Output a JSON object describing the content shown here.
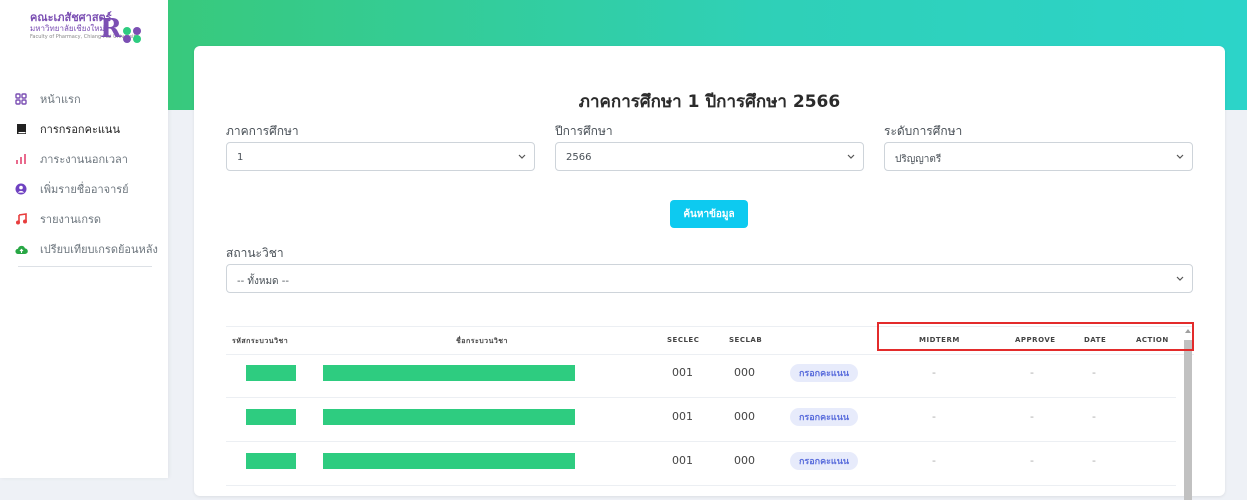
{
  "brand": {
    "line1": "คณะเภสัชศาสตร์",
    "line2": "มหาวิทยาลัยเชียงใหม่",
    "line3": "Faculty of Pharmacy, Chiang Mai University",
    "letter": "R",
    "colors": {
      "primary": "#7b4fb3",
      "accent": "#2ecc80"
    }
  },
  "sidebar": {
    "items": [
      {
        "label": "หน้าแรก",
        "icon": "dashboard-icon",
        "color": "#7b4fb3"
      },
      {
        "label": "การกรอกคะแนน",
        "icon": "book-icon",
        "color": "#222222"
      },
      {
        "label": "ภาระงานนอกเวลา",
        "icon": "bar-chart-icon",
        "color": "#e96a8d"
      },
      {
        "label": "เพิ่มรายชื่ออาจารย์",
        "icon": "user-circle-icon",
        "color": "#6f42c1"
      },
      {
        "label": "รายงานเกรด",
        "icon": "music-note-icon",
        "color": "#e83e3e"
      },
      {
        "label": "เปรียบเทียบเกรดย้อนหลัง",
        "icon": "cloud-upload-icon",
        "color": "#28a745"
      }
    ]
  },
  "main": {
    "title": "ภาคการศึกษา 1 ปีการศึกษา 2566",
    "filters": {
      "semester": {
        "label": "ภาคการศึกษา",
        "value": "1"
      },
      "year": {
        "label": "ปีการศึกษา",
        "value": "2566"
      },
      "level": {
        "label": "ระดับการศึกษา",
        "value": "ปริญญาตรี"
      },
      "status": {
        "label": "สถานะวิชา",
        "value": "-- ทั้งหมด --"
      }
    },
    "search_label": "ค้นหาข้อมูล",
    "table": {
      "headers": [
        "รหัสกระบวนวิชา",
        "ชื่อกระบวนวิชา",
        "SECLEC",
        "SECLAB",
        "MIDTERM",
        "APPROVE",
        "DATE",
        "ACTION"
      ],
      "rows": [
        {
          "seclec": "001",
          "seclab": "000",
          "action": "กรอกคะแนน",
          "midterm": "-",
          "approve": "-",
          "date": "-"
        },
        {
          "seclec": "001",
          "seclab": "000",
          "action": "กรอกคะแนน",
          "midterm": "-",
          "approve": "-",
          "date": "-"
        },
        {
          "seclec": "001",
          "seclab": "000",
          "action": "กรอกคะแนน",
          "midterm": "-",
          "approve": "-",
          "date": "-"
        }
      ]
    }
  }
}
